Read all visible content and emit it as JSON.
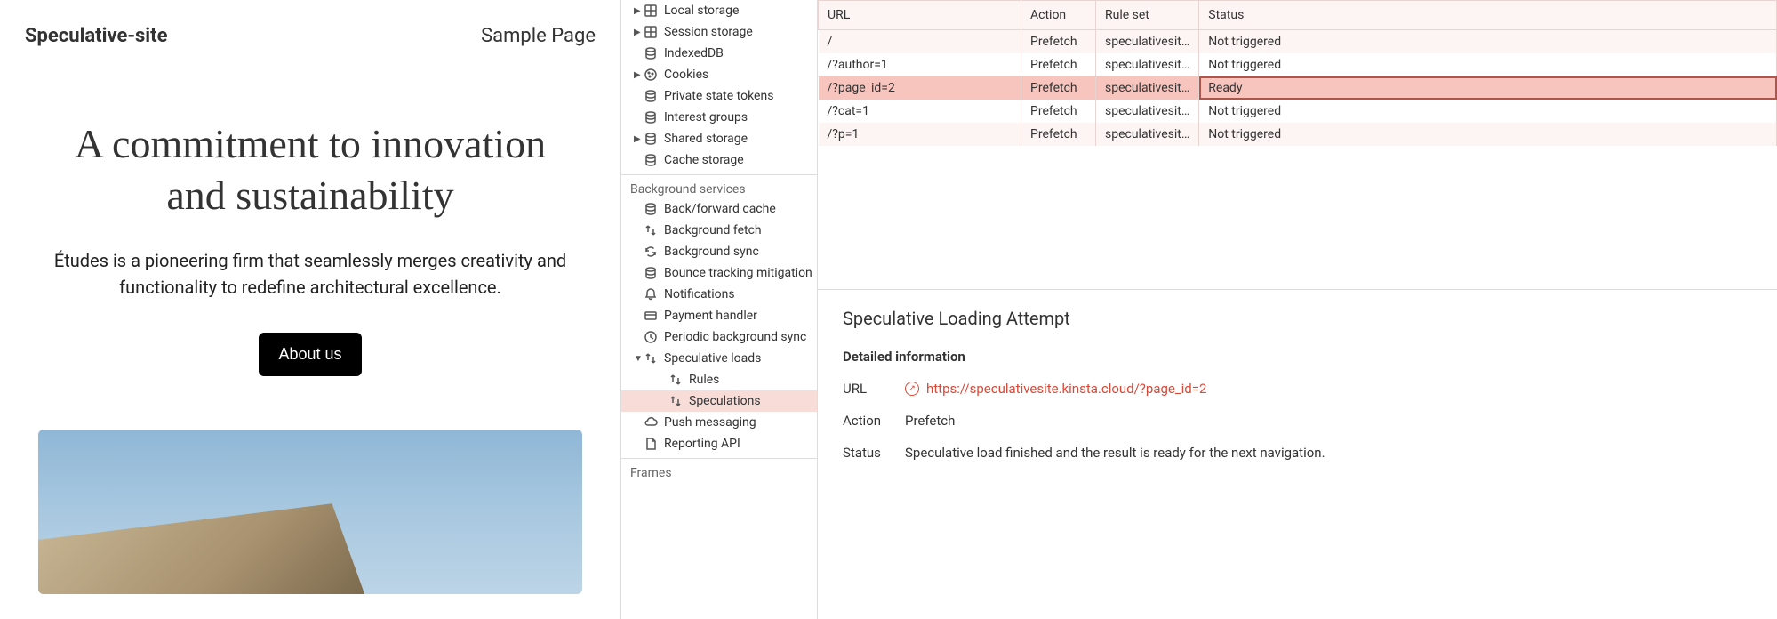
{
  "website": {
    "logo": "Speculative-site",
    "nav_item": "Sample Page",
    "hero_title": "A commitment to innovation and sustainability",
    "hero_sub": "Études is a pioneering firm that seamlessly merges creativity and functionality to redefine architectural excellence.",
    "hero_btn": "About us"
  },
  "sidebar": {
    "storage_items": [
      {
        "label": "Local storage",
        "icon": "grid",
        "arrow": "right"
      },
      {
        "label": "Session storage",
        "icon": "grid",
        "arrow": "right"
      },
      {
        "label": "IndexedDB",
        "icon": "db",
        "arrow": ""
      },
      {
        "label": "Cookies",
        "icon": "cookie",
        "arrow": "right"
      },
      {
        "label": "Private state tokens",
        "icon": "db",
        "arrow": ""
      },
      {
        "label": "Interest groups",
        "icon": "db",
        "arrow": ""
      },
      {
        "label": "Shared storage",
        "icon": "db",
        "arrow": "right"
      },
      {
        "label": "Cache storage",
        "icon": "db",
        "arrow": ""
      }
    ],
    "bg_label": "Background services",
    "bg_items": [
      {
        "label": "Back/forward cache",
        "icon": "db",
        "arrow": ""
      },
      {
        "label": "Background fetch",
        "icon": "updown",
        "arrow": ""
      },
      {
        "label": "Background sync",
        "icon": "sync",
        "arrow": ""
      },
      {
        "label": "Bounce tracking mitigation",
        "icon": "db",
        "arrow": ""
      },
      {
        "label": "Notifications",
        "icon": "bell",
        "arrow": ""
      },
      {
        "label": "Payment handler",
        "icon": "card",
        "arrow": ""
      },
      {
        "label": "Periodic background sync",
        "icon": "clock",
        "arrow": ""
      },
      {
        "label": "Speculative loads",
        "icon": "updown",
        "arrow": "down",
        "children": [
          {
            "label": "Rules",
            "icon": "updown"
          },
          {
            "label": "Speculations",
            "icon": "updown",
            "selected": true
          }
        ]
      },
      {
        "label": "Push messaging",
        "icon": "cloud",
        "arrow": ""
      },
      {
        "label": "Reporting API",
        "icon": "doc",
        "arrow": ""
      }
    ],
    "frames_label": "Frames"
  },
  "table": {
    "headers": {
      "url": "URL",
      "action": "Action",
      "ruleset": "Rule set",
      "status": "Status"
    },
    "rows": [
      {
        "url": "/",
        "action": "Prefetch",
        "ruleset": "speculativesit…",
        "status": "Not triggered",
        "hl": false
      },
      {
        "url": "/?author=1",
        "action": "Prefetch",
        "ruleset": "speculativesit…",
        "status": "Not triggered",
        "hl": false
      },
      {
        "url": "/?page_id=2",
        "action": "Prefetch",
        "ruleset": "speculativesit…",
        "status": "Ready",
        "hl": true
      },
      {
        "url": "/?cat=1",
        "action": "Prefetch",
        "ruleset": "speculativesit…",
        "status": "Not triggered",
        "hl": false
      },
      {
        "url": "/?p=1",
        "action": "Prefetch",
        "ruleset": "speculativesit…",
        "status": "Not triggered",
        "hl": false
      }
    ]
  },
  "detail": {
    "title": "Speculative Loading Attempt",
    "subtitle": "Detailed information",
    "url_key": "URL",
    "url_val": "https://speculativesite.kinsta.cloud/?page_id=2",
    "action_key": "Action",
    "action_val": "Prefetch",
    "status_key": "Status",
    "status_val": "Speculative load finished and the result is ready for the next navigation."
  }
}
